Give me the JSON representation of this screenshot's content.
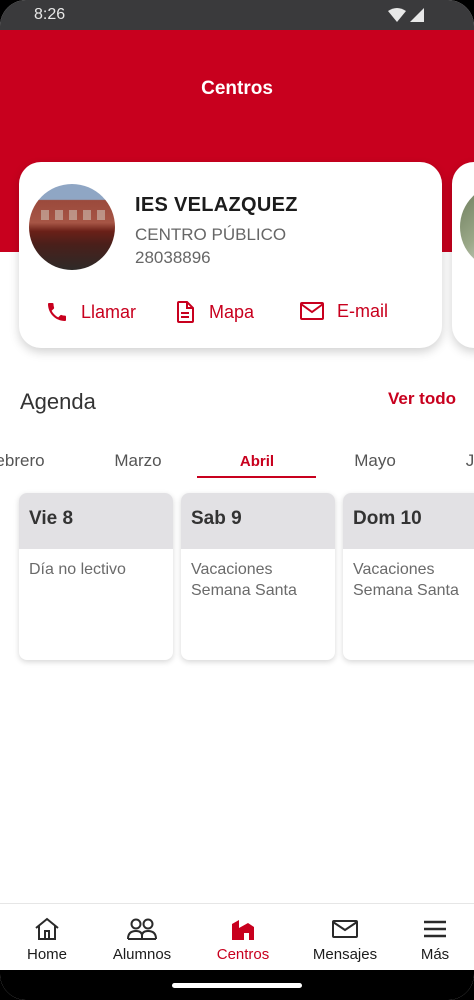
{
  "status_bar": {
    "time": "8:26"
  },
  "header": {
    "title": "Centros"
  },
  "school": {
    "name": "IES VELAZQUEZ",
    "type": "CENTRO PÚBLICO",
    "code": "28038896"
  },
  "actions": {
    "call_label": "Llamar",
    "map_label": "Mapa",
    "email_label": "E-mail"
  },
  "agenda": {
    "title": "Agenda",
    "see_all": "Ver todo",
    "months": [
      "ebrero",
      "Marzo",
      "Abril",
      "Mayo",
      "J"
    ],
    "active_month": "Abril",
    "days": [
      {
        "day": "Vie 8",
        "lines": [
          "Día no lectivo",
          ""
        ]
      },
      {
        "day": "Sab 9",
        "lines": [
          "Vacaciones",
          "Semana Santa"
        ]
      },
      {
        "day": "Dom 10",
        "lines": [
          "Vacaciones",
          "Semana Santa"
        ]
      }
    ]
  },
  "nav": {
    "items": [
      {
        "label": "Home",
        "icon": "home-icon"
      },
      {
        "label": "Alumnos",
        "icon": "people-icon"
      },
      {
        "label": "Centros",
        "icon": "building-icon"
      },
      {
        "label": "Mensajes",
        "icon": "mail-icon"
      },
      {
        "label": "Más",
        "icon": "menu-icon"
      }
    ],
    "active": "Centros"
  },
  "colors": {
    "brand": "#c8001e",
    "day_header": "#e2e1e4"
  }
}
